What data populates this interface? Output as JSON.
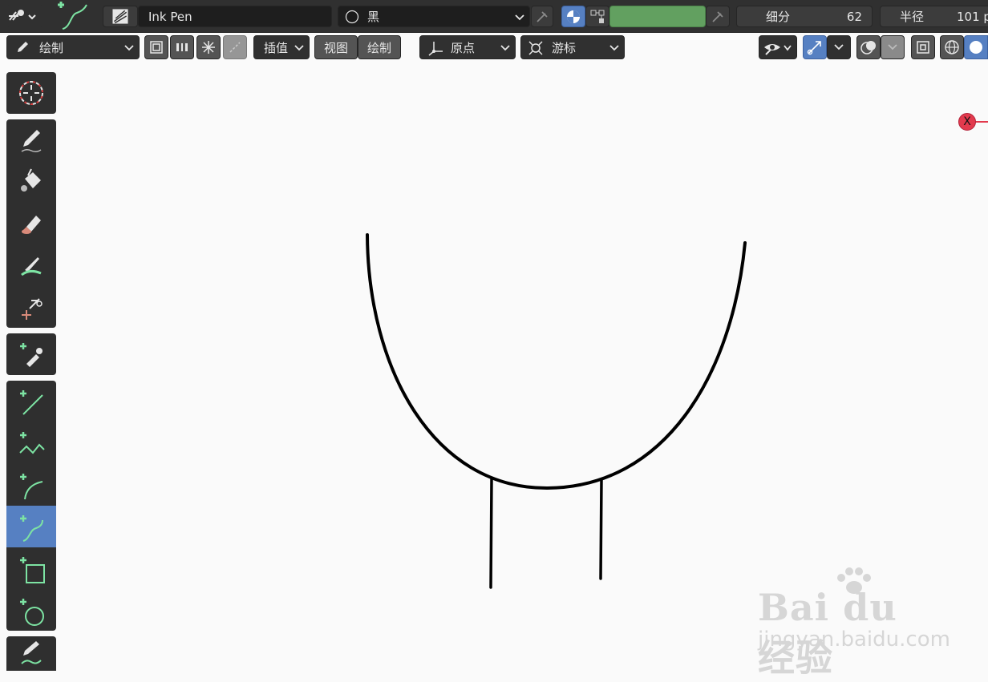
{
  "header": {
    "brush_name": "Ink Pen",
    "material_name": "黑",
    "subdivide_label": "细分",
    "subdivide_value": "62",
    "radius_label": "半径",
    "radius_value": "101 p",
    "accent_color": "#5680c2",
    "stroke_color": "#62a060"
  },
  "toolbar": {
    "mode_label": "绘制",
    "interpolate_label": "插值",
    "view_label": "视图",
    "draw_label": "绘制",
    "origin_label": "原点",
    "cursor_label": "游标"
  },
  "tools": [
    {
      "name": "cursor",
      "icon": "cursor-icon"
    },
    {
      "name": "draw",
      "icon": "pencil-icon"
    },
    {
      "name": "fill",
      "icon": "bucket-icon"
    },
    {
      "name": "erase",
      "icon": "eraser-icon"
    },
    {
      "name": "tint",
      "icon": "tint-brush-icon"
    },
    {
      "name": "cutter",
      "icon": "cutter-icon"
    },
    {
      "name": "eyedropper",
      "icon": "eyedropper-icon"
    },
    {
      "name": "line",
      "icon": "line-icon"
    },
    {
      "name": "polyline",
      "icon": "polyline-icon"
    },
    {
      "name": "arc",
      "icon": "arc-icon"
    },
    {
      "name": "curve",
      "icon": "curve-icon",
      "selected": true
    },
    {
      "name": "box",
      "icon": "box-icon"
    },
    {
      "name": "circle",
      "icon": "circle-icon"
    },
    {
      "name": "annotate",
      "icon": "annotate-icon"
    }
  ],
  "viewport": {
    "axis_label": "X",
    "axis_color": "#e23a4d"
  },
  "watermark": {
    "logo_text": "Bai du 经验",
    "url_text": "jingyan.baidu.com"
  }
}
